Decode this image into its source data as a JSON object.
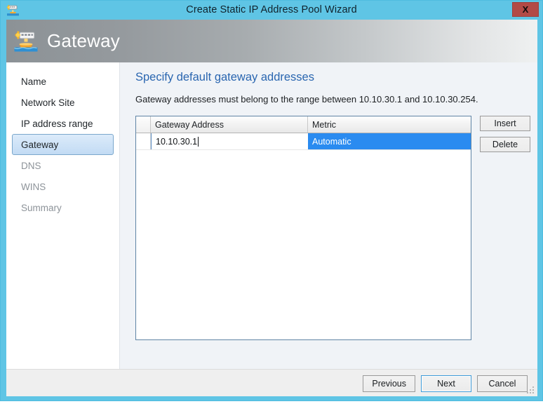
{
  "window": {
    "title": "Create Static IP Address Pool Wizard",
    "close_label": "X",
    "title_icon": "ip-address-pool-icon",
    "titlebar_color": "#5fc5e5",
    "close_color": "#b24a46"
  },
  "banner": {
    "title": "Gateway",
    "icon": "gateway-icon"
  },
  "sidebar": {
    "items": [
      {
        "label": "Name",
        "state": "done"
      },
      {
        "label": "Network Site",
        "state": "done"
      },
      {
        "label": "IP address range",
        "state": "done"
      },
      {
        "label": "Gateway",
        "state": "selected"
      },
      {
        "label": "DNS",
        "state": "disabled"
      },
      {
        "label": "WINS",
        "state": "disabled"
      },
      {
        "label": "Summary",
        "state": "disabled"
      }
    ],
    "selected_accent": "#7aa7cc"
  },
  "content": {
    "heading": "Specify default gateway addresses",
    "heading_color": "#2a66b0",
    "description": "Gateway addresses must belong to the range between 10.10.30.1 and 10.10.30.254.",
    "grid": {
      "columns": [
        "Gateway Address",
        "Metric"
      ],
      "rows": [
        {
          "gateway_address": "10.10.30.1",
          "metric": "Automatic",
          "metric_selected": true
        }
      ],
      "selection_color": "#2a8bf0"
    },
    "side_buttons": {
      "insert": "Insert",
      "delete": "Delete"
    }
  },
  "footer": {
    "previous": "Previous",
    "next": "Next",
    "cancel": "Cancel",
    "default_button": "Next"
  }
}
